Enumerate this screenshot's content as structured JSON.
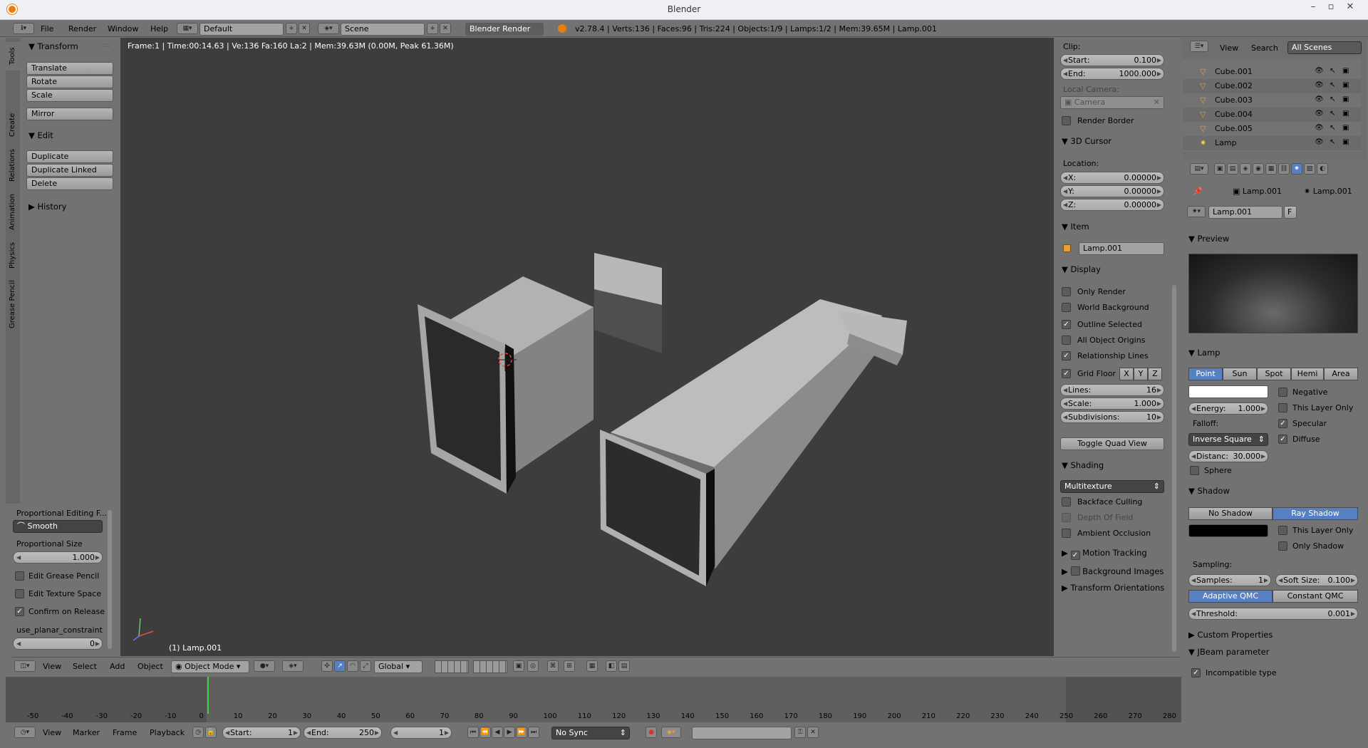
{
  "window": {
    "title": "Blender"
  },
  "info_header": {
    "menus": [
      "File",
      "Render",
      "Window",
      "Help"
    ],
    "layout": "Default",
    "scene": "Scene",
    "engine": "Blender Render",
    "stats": "v2.78.4 | Verts:136 | Faces:96 | Tris:224 | Objects:1/9 | Lamps:1/2 | Mem:39.65M | Lamp.001"
  },
  "viewport": {
    "overlay": "Frame:1 | Time:00:14.63 | Ve:136 Fa:160 La:2 | Mem:39.63M (0.00M, Peak 61.36M)",
    "object_label": "(1) Lamp.001",
    "header": {
      "menus": [
        "View",
        "Select",
        "Add",
        "Object"
      ],
      "mode": "Object Mode",
      "orientation": "Global"
    }
  },
  "tool_tabs": [
    "Tools",
    "Create",
    "Relations",
    "Animation",
    "Physics",
    "Grease Pencil"
  ],
  "tool_shelf": {
    "transform": {
      "title": "Transform",
      "buttons": [
        "Translate",
        "Rotate",
        "Scale",
        "Mirror"
      ]
    },
    "edit": {
      "title": "Edit",
      "buttons": [
        "Duplicate",
        "Duplicate Linked",
        "Delete"
      ]
    },
    "history": {
      "title": "History"
    }
  },
  "operator_panel": {
    "title": "Proportional Editing F...",
    "falloff": "Smooth",
    "size_label": "Proportional Size",
    "size_value": "1.000",
    "checks": [
      {
        "label": "Edit Grease Pencil",
        "checked": false
      },
      {
        "label": "Edit Texture Space",
        "checked": false
      },
      {
        "label": "Confirm on Release",
        "checked": true
      }
    ],
    "constraint_label": "use_planar_constraint",
    "constraint_value": "0"
  },
  "properties_n": {
    "clip_label": "Clip:",
    "start_label": "Start:",
    "start_value": "0.100",
    "end_label": "End:",
    "end_value": "1000.000",
    "local_camera_label": "Local Camera:",
    "camera": "Camera",
    "render_border": "Render Border",
    "cursor_title": "3D Cursor",
    "location_label": "Location:",
    "x_label": "X:",
    "x_value": "0.00000",
    "y_label": "Y:",
    "y_value": "0.00000",
    "z_label": "Z:",
    "z_value": "0.00000",
    "item_title": "Item",
    "item_name": "Lamp.001",
    "display_title": "Display",
    "display_checks": [
      {
        "label": "Only Render",
        "checked": false
      },
      {
        "label": "World Background",
        "checked": false
      },
      {
        "label": "Outline Selected",
        "checked": true
      },
      {
        "label": "All Object Origins",
        "checked": false
      },
      {
        "label": "Relationship Lines",
        "checked": true
      }
    ],
    "grid_floor": "Grid Floor",
    "axes": [
      "X",
      "Y",
      "Z"
    ],
    "lines_label": "Lines:",
    "lines_value": "16",
    "scale_label": "Scale:",
    "scale_value": "1.000",
    "subdiv_label": "Subdivisions:",
    "subdiv_value": "10",
    "quad_view": "Toggle Quad View",
    "shading_title": "Shading",
    "shading_mode": "Multitexture",
    "shading_checks": [
      {
        "label": "Backface Culling",
        "checked": false
      },
      {
        "label": "Depth Of Field",
        "checked": false,
        "dim": true
      },
      {
        "label": "Ambient Occlusion",
        "checked": false
      }
    ],
    "motion_tracking": "Motion Tracking",
    "background_images": "Background Images",
    "transform_orientations": "Transform Orientations"
  },
  "outliner": {
    "menus": [
      "View",
      "Search"
    ],
    "filter": "All Scenes",
    "items": [
      "Cube.001",
      "Cube.002",
      "Cube.003",
      "Cube.004",
      "Cube.005",
      "Lamp"
    ]
  },
  "properties": {
    "breadcrumb_1": "Lamp.001",
    "breadcrumb_2": "Lamp.001",
    "datablock": "Lamp.001",
    "fake_user": "F",
    "preview_title": "Preview",
    "lamp_title": "Lamp",
    "lamp_types": [
      "Point",
      "Sun",
      "Spot",
      "Hemi",
      "Area"
    ],
    "lamp_type_active": "Point",
    "negative": "Negative",
    "this_layer_only": "This Layer Only",
    "specular": "Specular",
    "diffuse": "Diffuse",
    "energy_label": "Energy:",
    "energy_value": "1.000",
    "falloff_label": "Falloff:",
    "falloff": "Inverse Square",
    "distance_label": "Distanc:",
    "distance_value": "30.000",
    "sphere": "Sphere",
    "shadow_title": "Shadow",
    "no_shadow": "No Shadow",
    "ray_shadow": "Ray Shadow",
    "shadow_layer_only": "This Layer Only",
    "only_shadow": "Only Shadow",
    "sampling_label": "Sampling:",
    "samples_label": "Samples:",
    "samples_value": "1",
    "soft_size_label": "Soft Size:",
    "soft_size_value": "0.100",
    "adaptive_qmc": "Adaptive QMC",
    "constant_qmc": "Constant QMC",
    "threshold_label": "Threshold:",
    "threshold_value": "0.001",
    "custom_props": "Custom Properties",
    "jbeam_title": "JBeam parameter",
    "incompatible": "Incompatible type"
  },
  "timeline": {
    "ticks": [
      "-50",
      "-40",
      "-30",
      "-20",
      "-10",
      "0",
      "10",
      "20",
      "30",
      "40",
      "50",
      "60",
      "70",
      "80",
      "90",
      "100",
      "110",
      "120",
      "130",
      "140",
      "150",
      "160",
      "170",
      "180",
      "190",
      "200",
      "210",
      "220",
      "230",
      "240",
      "250",
      "260",
      "270",
      "280"
    ],
    "menus": [
      "View",
      "Marker",
      "Frame",
      "Playback"
    ],
    "start_label": "Start:",
    "start_value": "1",
    "end_label": "End:",
    "end_value": "250",
    "current": "1",
    "sync": "No Sync"
  },
  "colors": {
    "accent": "#5680c2",
    "viewport_bg": "#3d3d3d",
    "panel_bg": "#727272"
  }
}
